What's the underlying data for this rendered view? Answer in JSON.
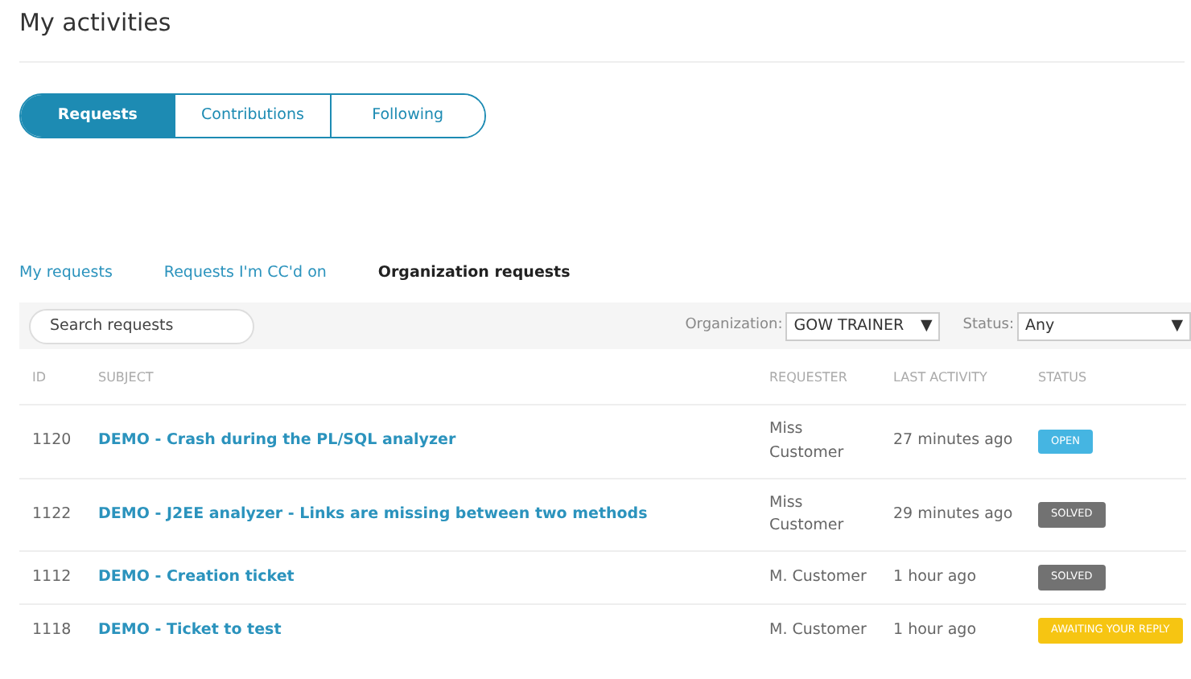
{
  "title": "My activities",
  "tabs": [
    {
      "label": "Requests",
      "selected": true
    },
    {
      "label": "Contributions",
      "selected": false
    },
    {
      "label": "Following",
      "selected": false
    }
  ],
  "subtabs": [
    {
      "label": "My requests",
      "selected": false
    },
    {
      "label": "Requests I'm CC'd on",
      "selected": false
    },
    {
      "label": "Organization requests",
      "selected": true
    }
  ],
  "search": {
    "placeholder": "Search requests"
  },
  "filters": [
    {
      "label": "Organization:",
      "value": "GOW TRAINER",
      "arrow": "▼",
      "kind": "narrow"
    },
    {
      "label": "Status:",
      "value": "Any",
      "arrow": "▼",
      "kind": "wide"
    }
  ],
  "table": {
    "columns": [
      "ID",
      "SUBJECT",
      "REQUESTER",
      "LAST ACTIVITY",
      "STATUS"
    ],
    "rows": [
      {
        "id": "1120",
        "subject": "DEMO - Crash during the PL/SQL analyzer",
        "requester": "Miss Customer",
        "last_activity": "27 minutes ago",
        "status": "OPEN",
        "kind": "open"
      },
      {
        "id": "1122",
        "subject": "DEMO - J2EE analyzer - Links are missing between two methods",
        "requester": "Miss Customer",
        "last_activity": "29 minutes ago",
        "status": "SOLVED",
        "kind": "solved"
      },
      {
        "id": "1112",
        "subject": "DEMO - Creation ticket",
        "requester": "M. Customer",
        "last_activity": "1 hour ago",
        "status": "SOLVED",
        "kind": "solved"
      },
      {
        "id": "1118",
        "subject": "DEMO - Ticket to test",
        "requester": "M. Customer",
        "last_activity": "1 hour ago",
        "status": "AWAITING YOUR REPLY",
        "kind": "awaiting"
      }
    ]
  }
}
